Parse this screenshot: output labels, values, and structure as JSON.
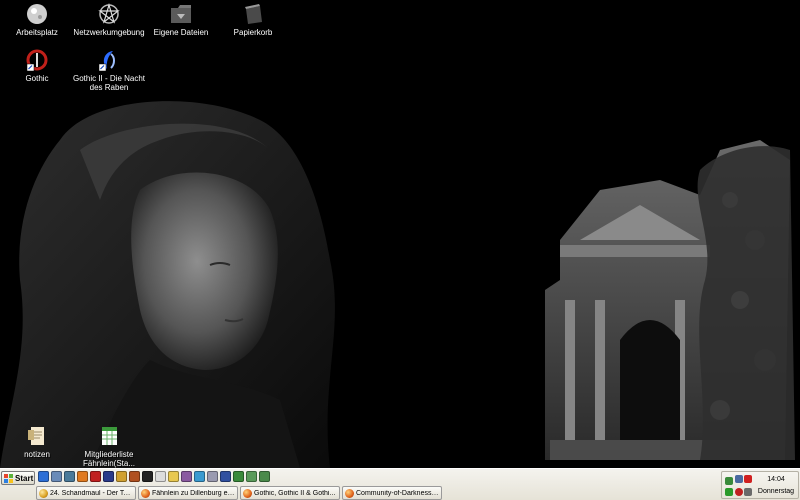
{
  "desktop": {
    "icons": [
      {
        "label": "Arbeitsplatz",
        "icon": "my-computer-icon"
      },
      {
        "label": "Netzwerkumgebung",
        "icon": "network-places-icon"
      },
      {
        "label": "Eigene Dateien",
        "icon": "my-documents-icon"
      },
      {
        "label": "Papierkorb",
        "icon": "recycle-bin-icon"
      },
      {
        "label": "Gothic",
        "icon": "gothic-shortcut-icon"
      },
      {
        "label": "Gothic II - Die Nacht des Raben",
        "icon": "gothic2-shortcut-icon"
      },
      {
        "label": "notizen",
        "icon": "text-file-icon"
      },
      {
        "label": "Mitgliederliste Fähnlein(Sta...",
        "icon": "spreadsheet-file-icon"
      }
    ]
  },
  "taskbar": {
    "start_label": "Start",
    "quick_launch": [
      "ie-icon",
      "desktop-icon",
      "media-icon",
      "firefox-icon",
      "opera-icon",
      "save-icon",
      "tool-icon",
      "app-icon",
      "cmd-icon",
      "doc-icon",
      "folder-icon",
      "rar-icon",
      "globe-icon",
      "cd-icon",
      "calc-icon",
      "chart-icon",
      "game-icon",
      "net-icon"
    ],
    "tasks": [
      {
        "label": "24. Schandmaul - Der Tal..."
      },
      {
        "label": "Fähnlein zu Dillenburg e...."
      },
      {
        "label": "Gothic, Gothic II & Gothi..."
      },
      {
        "label": "Community-of-Darkness ..."
      }
    ]
  },
  "tray": {
    "time": "14:04",
    "day": "Donnerstag"
  }
}
